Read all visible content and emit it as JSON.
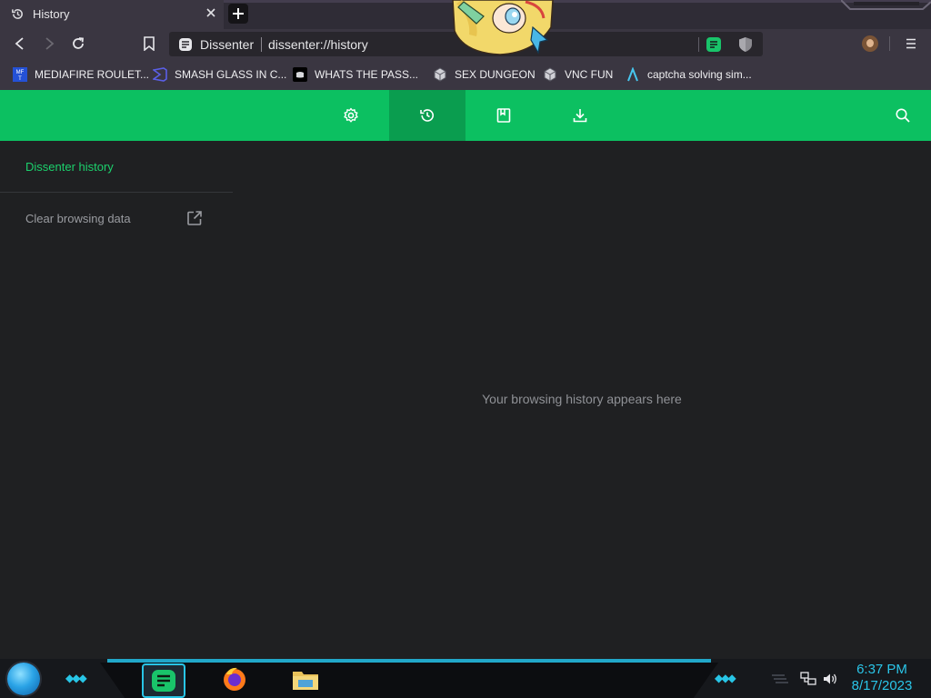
{
  "browser": {
    "tab": {
      "title": "History",
      "icon": "history-icon"
    },
    "omnibox": {
      "site_name": "Dissenter",
      "url": "dissenter://history"
    },
    "bookmarks": [
      {
        "label": "MEDIAFIRE ROULET...",
        "icon": "mediafire-icon"
      },
      {
        "label": "SMASH GLASS IN C...",
        "icon": "visual-studio-icon"
      },
      {
        "label": "WHATS THE PASS...",
        "icon": "discord-icon"
      },
      {
        "label": "SEX DUNGEON",
        "icon": "cube-icon"
      },
      {
        "label": "VNC FUN",
        "icon": "cube-icon"
      },
      {
        "label": "captcha solving sim...",
        "icon": "triangle-logo-icon"
      }
    ]
  },
  "history_page": {
    "header_buttons": [
      "settings-icon",
      "history-icon",
      "bookmarks-icon",
      "downloads-icon"
    ],
    "active_button": "history-icon",
    "sidebar": {
      "active_item": "Dissenter history",
      "clear_item": "Clear browsing data"
    },
    "empty_message": "Your browsing history appears here"
  },
  "taskbar": {
    "apps": [
      "dissenter-icon",
      "firefox-icon",
      "file-explorer-icon"
    ],
    "time": "6:37 PM",
    "date": "8/17/2023"
  },
  "colors": {
    "accent_green": "#0cc061",
    "active_green": "#0a9d4f",
    "sidebar_active_text": "#1cd06c",
    "clock_cyan": "#2ac5e8"
  }
}
